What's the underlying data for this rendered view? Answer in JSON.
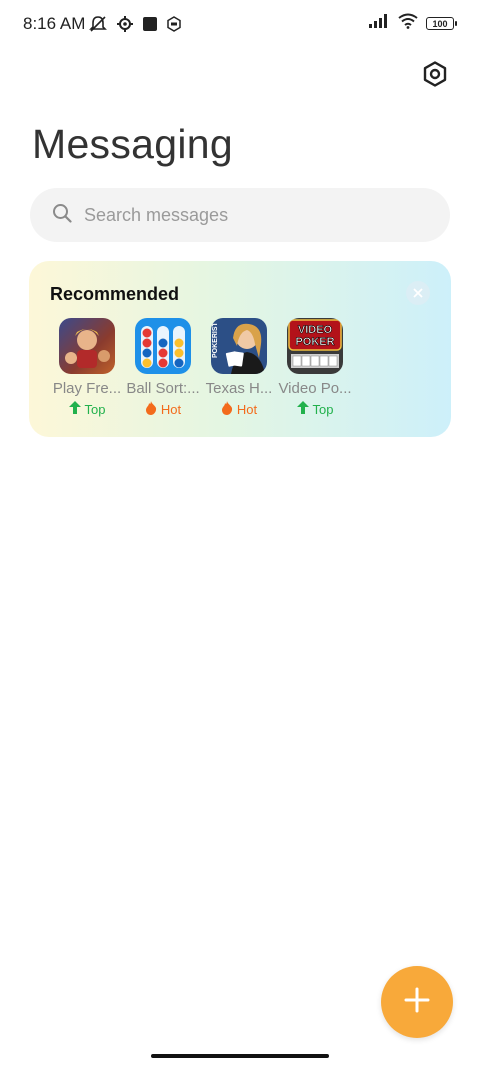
{
  "status_bar": {
    "time": "8:16 AM",
    "battery": "100"
  },
  "header": {
    "title": "Messaging"
  },
  "search": {
    "placeholder": "Search messages"
  },
  "recommended": {
    "title": "Recommended",
    "apps": [
      {
        "name": "Play Fre...",
        "badge": "Top",
        "badge_type": "top"
      },
      {
        "name": "Ball Sort:...",
        "badge": "Hot",
        "badge_type": "hot"
      },
      {
        "name": "Texas H...",
        "badge": "Hot",
        "badge_type": "hot"
      },
      {
        "name": "Video Po...",
        "badge": "Top",
        "badge_type": "top"
      }
    ],
    "video_poker_icon_text": [
      "VIDEO",
      "POKER"
    ],
    "pokerist_icon_text": "POKERIST"
  },
  "colors": {
    "accent": "#f8a93a",
    "top_badge": "#22b14c",
    "hot_badge": "#f36b1c"
  }
}
